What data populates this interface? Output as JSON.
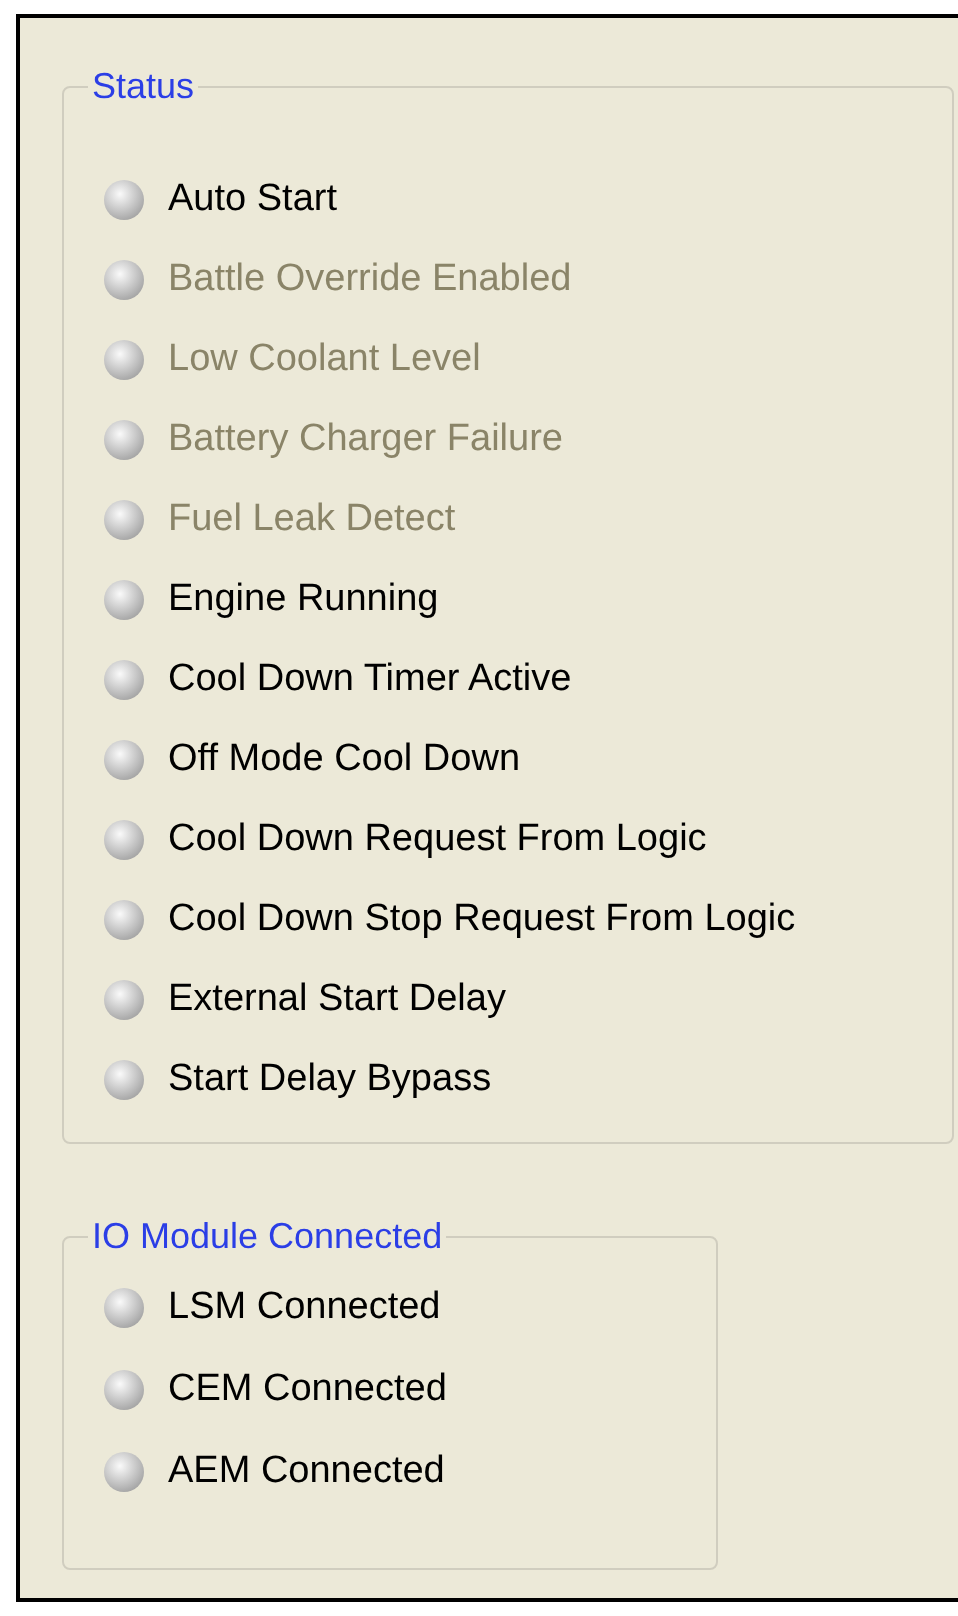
{
  "groups": [
    {
      "title": "Status",
      "items": [
        {
          "label": "Auto Start",
          "disabled": false,
          "on": false
        },
        {
          "label": "Battle Override Enabled",
          "disabled": true,
          "on": false
        },
        {
          "label": "Low Coolant Level",
          "disabled": true,
          "on": false
        },
        {
          "label": "Battery Charger Failure",
          "disabled": true,
          "on": false
        },
        {
          "label": "Fuel Leak Detect",
          "disabled": true,
          "on": false
        },
        {
          "label": "Engine Running",
          "disabled": false,
          "on": false
        },
        {
          "label": "Cool Down Timer Active",
          "disabled": false,
          "on": false
        },
        {
          "label": "Off Mode Cool Down",
          "disabled": false,
          "on": false
        },
        {
          "label": "Cool Down Request From Logic",
          "disabled": false,
          "on": false
        },
        {
          "label": "Cool Down Stop Request From Logic",
          "disabled": false,
          "on": false
        },
        {
          "label": "External Start Delay",
          "disabled": false,
          "on": false
        },
        {
          "label": "Start Delay Bypass",
          "disabled": false,
          "on": false
        }
      ]
    },
    {
      "title": "IO Module Connected",
      "items": [
        {
          "label": "LSM Connected",
          "disabled": false,
          "on": false
        },
        {
          "label": "CEM Connected",
          "disabled": false,
          "on": false
        },
        {
          "label": "AEM Connected",
          "disabled": false,
          "on": false
        }
      ]
    }
  ]
}
